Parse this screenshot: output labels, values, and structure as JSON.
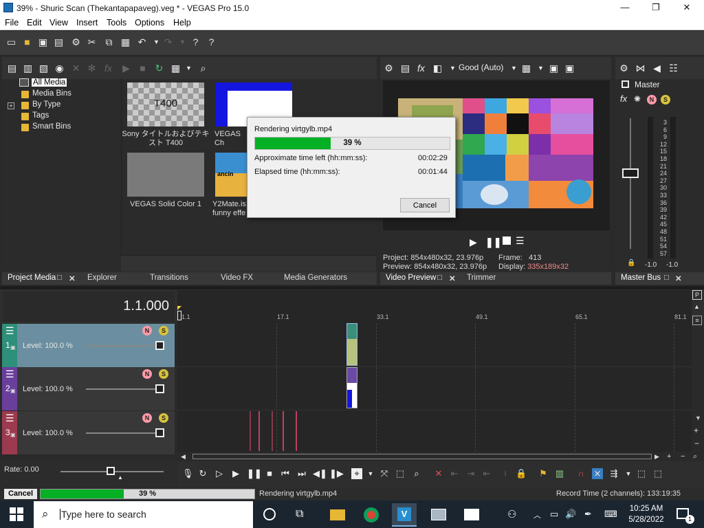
{
  "window": {
    "title": "39% - Shuric Scan (Thekantapapaveg).veg * - VEGAS Pro 15.0",
    "minimize": "—",
    "maximize": "❐",
    "close": "✕"
  },
  "menu": [
    "File",
    "Edit",
    "View",
    "Insert",
    "Tools",
    "Options",
    "Help"
  ],
  "media_tree": {
    "all_media": "All Media",
    "media_bins": "Media Bins",
    "by_type": "By Type",
    "tags": "Tags",
    "smart_bins": "Smart Bins",
    "expander": "+"
  },
  "media_items": [
    {
      "thumb_text": "T400",
      "caption": "Sony タイトルおよびテキスト T400"
    },
    {
      "caption": "VEGAS Ch"
    },
    {
      "caption": "VEGAS Solid Color 1"
    },
    {
      "caption": "Y2Mate.is funny effe"
    }
  ],
  "render_dialog": {
    "title": "Rendering virtgylb.mp4",
    "progress_label": "39 %",
    "progress": 0.39,
    "time_left_label": "Approximate time left (hh:mm:ss):",
    "time_left": "00:02:29",
    "elapsed_label": "Elapsed time (hh:mm:ss):",
    "elapsed": "00:01:44",
    "cancel": "Cancel"
  },
  "preview": {
    "quality": "Good (Auto)",
    "project_label": "Project:",
    "project": "854x480x32, 23.976p",
    "frame_label": "Frame:",
    "frame": "413",
    "preview_label": "Preview:",
    "preview": "854x480x32, 23.976p",
    "display_label": "Display:",
    "display": "335x189x32"
  },
  "master": {
    "label": "Master",
    "scale": [
      "3",
      "6",
      "9",
      "12",
      "15",
      "18",
      "21",
      "24",
      "27",
      "30",
      "33",
      "36",
      "39",
      "42",
      "45",
      "48",
      "51",
      "54",
      "57"
    ],
    "left_val": "-1.0",
    "right_val": "-1.0"
  },
  "tabs": {
    "project_media": "Project Media",
    "explorer": "Explorer",
    "transitions": "Transitions",
    "video_fx": "Video FX",
    "media_generators": "Media Generators",
    "video_preview": "Video Preview",
    "trimmer": "Trimmer",
    "master_bus": "Master Bus"
  },
  "timeline": {
    "timecode": "1.1.000",
    "ruler": [
      "1.1",
      "17.1",
      "33.1",
      "49.1",
      "65.1",
      "81.1"
    ],
    "tracks": [
      {
        "num": "1",
        "level": "Level: 100.0 %",
        "color": "#2e8f7a"
      },
      {
        "num": "2",
        "level": "Level: 100.0 %",
        "color": "#6a3f9c"
      },
      {
        "num": "3",
        "level": "Level: 100.0 %",
        "color": "#9c3a4f"
      }
    ],
    "rate": "Rate: 0.00"
  },
  "status": {
    "cancel": "Cancel",
    "progress_label": "39 %",
    "progress": 0.39,
    "rendering": "Rendering virtgylb.mp4",
    "record_time": "Record Time (2 channels): 133:19:35"
  },
  "taskbar": {
    "search_placeholder": "Type here to search",
    "time": "10:25 AM",
    "date": "5/28/2022",
    "notif_count": "1"
  },
  "colors": {
    "accent_green": "#06b025",
    "track1": "#2e8f7a",
    "track2": "#6a3f9c",
    "track3": "#9c3a4f"
  }
}
